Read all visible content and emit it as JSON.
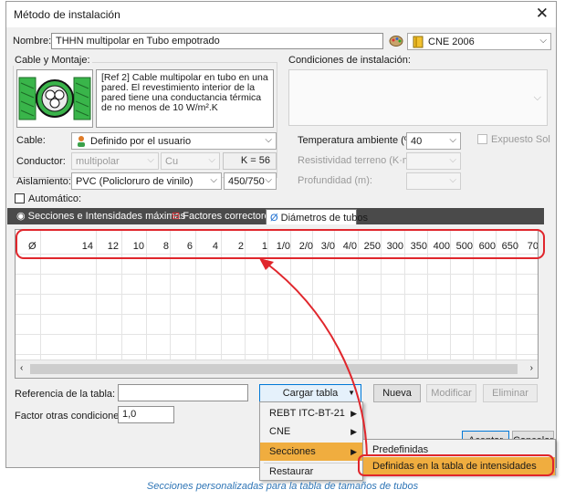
{
  "window": {
    "title": "Método de instalación",
    "close_glyph": "✕"
  },
  "name_row": {
    "label": "Nombre:",
    "value": "THHN multipolar en Tubo empotrado",
    "norm_value": "CNE 2006"
  },
  "cable_group": {
    "label": "Cable y Montaje:",
    "description": "[Ref 2] Cable multipolar en tubo en una pared. El revestimiento interior de la pared tiene una conductancia térmica de no menos de 10 W/m².K"
  },
  "cable": {
    "label": "Cable:",
    "value": "Definido por el usuario"
  },
  "conductor": {
    "label": "Conductor:",
    "type_value": "multipolar",
    "material_value": "Cu",
    "k_label": "K = 56"
  },
  "aislamiento": {
    "label": "Aislamiento:",
    "value": "PVC (Policloruro de vinilo)",
    "voltage_value": "450/750"
  },
  "conditions": {
    "label": "Condiciones de instalación:",
    "temp_label": "Temperatura ambiente (ºC):",
    "temp_value": "40",
    "exposed_label": "Expuesto Sol",
    "resistivity_label": "Resistividad terreno (K·m/W):",
    "depth_label": "Profundidad (m):"
  },
  "automatic": {
    "label": "Automático:"
  },
  "tabs": [
    {
      "label": "Secciones e Intensidades máximas",
      "icon": "sections-icon"
    },
    {
      "label": "Factores correctores",
      "icon": "correction-factors-icon"
    },
    {
      "label": "Diámetros de tubos",
      "icon": "diameter-icon"
    }
  ],
  "grid": {
    "headers": [
      "Ø",
      "14",
      "12",
      "10",
      "8",
      "6",
      "4",
      "2",
      "1",
      "1/0",
      "2/0",
      "3/0",
      "4/0",
      "250",
      "300",
      "350",
      "400",
      "500",
      "600",
      "650",
      "70"
    ]
  },
  "bottom": {
    "ref_label": "Referencia de la tabla:",
    "ref_value": "",
    "cargar_label": "Cargar tabla",
    "nueva_label": "Nueva",
    "modificar_label": "Modificar",
    "eliminar_label": "Eliminar",
    "factor_label": "Factor otras condiciones:",
    "factor_value": "1,0",
    "aceptar_label": "Aceptar",
    "cancelar_label": "Cancelar"
  },
  "menu": {
    "items": [
      "REBT ITC-BT-21",
      "CNE",
      "Secciones",
      "Restaurar"
    ],
    "submenu": [
      "Predefinidas",
      "Definidas en la tabla de intensidades"
    ]
  },
  "caption": "Secciones personalizadas para la tabla de tamaños de tubos",
  "colors": {
    "highlight": "#f0ad3f",
    "annotation_red": "#e0262c",
    "tab_bar": "#4a4a4a",
    "caption": "#2e75b6"
  }
}
